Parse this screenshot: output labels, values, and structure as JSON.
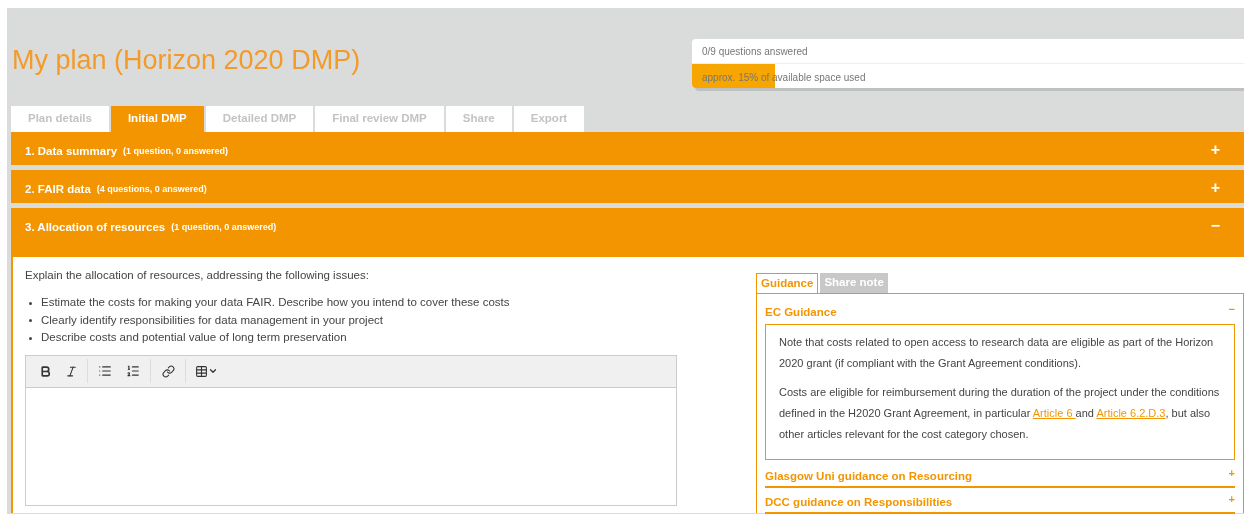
{
  "title": "My plan (Horizon 2020 DMP)",
  "progress": {
    "answered": "0/9 questions answered",
    "space": "approx. 15% of available space used",
    "level": 0.15
  },
  "tabs": [
    {
      "label": "Plan details",
      "selected": false
    },
    {
      "label": "Initial DMP",
      "selected": true
    },
    {
      "label": "Detailed DMP",
      "selected": false
    },
    {
      "label": "Final review DMP",
      "selected": false
    },
    {
      "label": "Share",
      "selected": false
    },
    {
      "label": "Export",
      "selected": false
    }
  ],
  "sections": [
    {
      "title": "1. Data summary",
      "count": "(1 question, 0 answered)",
      "expanded": false,
      "toggle": "+"
    },
    {
      "title": "2. FAIR data",
      "count": "(4 questions, 0 answered)",
      "expanded": false,
      "toggle": "+"
    },
    {
      "title": "3. Allocation of resources",
      "count": "(1 question, 0 answered)",
      "expanded": true,
      "toggle": "−"
    }
  ],
  "question": {
    "intro": "Explain the allocation of resources, addressing the following issues:",
    "bullets": [
      "Estimate the costs for making your data FAIR. Describe how you intend to cover these costs",
      "Clearly identify responsibilities for data management in your project",
      "Describe costs and potential value of long term preservation"
    ]
  },
  "guidance_tabs": [
    {
      "label": "Guidance",
      "selected": true
    },
    {
      "label": "Share note",
      "selected": false
    }
  ],
  "guidance": [
    {
      "title": "EC Guidance",
      "expanded": true,
      "toggle": "−",
      "paragraphs": [
        [
          {
            "kind": "text",
            "text": "Note that costs related to open access to research data are eligible as part of the Horizon 2020 grant (if compliant with the Grant Agreement conditions)."
          }
        ],
        [
          {
            "kind": "text",
            "text": "Costs are eligible for reimbursement during the duration of the project under the conditions defined in the H2020 Grant Agreement, in particular "
          },
          {
            "kind": "link",
            "text": "Article 6 "
          },
          {
            "kind": "text",
            "text": "and "
          },
          {
            "kind": "link",
            "text": "Article 6.2.D.3"
          },
          {
            "kind": "text",
            "text": ", but also other articles relevant for the cost category chosen."
          }
        ]
      ]
    },
    {
      "title": "Glasgow Uni guidance on Resourcing",
      "expanded": false,
      "toggle": "+"
    },
    {
      "title": "DCC guidance on Responsibilities",
      "expanded": false,
      "toggle": "+"
    }
  ]
}
